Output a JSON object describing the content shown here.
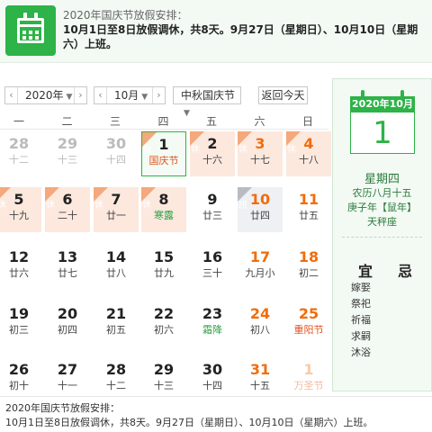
{
  "banner": {
    "icon": "calendar-icon",
    "title": "2020年国庆节放假安排：",
    "text": "10月1日至8日放假调休，共8天。9月27日（星期日）、10月10日（星期六）上班。"
  },
  "toolbar": {
    "year": "2020年",
    "month": "10月",
    "holiday": "中秋国庆节",
    "today_button": "返回今天",
    "prev": "‹",
    "next": "›"
  },
  "weekdays": [
    "一",
    "二",
    "三",
    "四",
    "五",
    "六",
    "日"
  ],
  "days": [
    {
      "num": "28",
      "lunar": "十二",
      "other": true
    },
    {
      "num": "29",
      "lunar": "十三",
      "other": true
    },
    {
      "num": "30",
      "lunar": "十四",
      "other": true
    },
    {
      "num": "1",
      "lunar": "国庆节",
      "tag": "休",
      "festival": true,
      "selected": true
    },
    {
      "num": "2",
      "lunar": "十六",
      "tag": "休"
    },
    {
      "num": "3",
      "lunar": "十七",
      "tag": "休",
      "weekend": true
    },
    {
      "num": "4",
      "lunar": "十八",
      "tag": "休",
      "weekend": true
    },
    {
      "num": "5",
      "lunar": "十九",
      "tag": "休"
    },
    {
      "num": "6",
      "lunar": "二十",
      "tag": "休"
    },
    {
      "num": "7",
      "lunar": "廿一",
      "tag": "休"
    },
    {
      "num": "8",
      "lunar": "寒露",
      "tag": "休",
      "green": true
    },
    {
      "num": "9",
      "lunar": "廿三"
    },
    {
      "num": "10",
      "lunar": "廿四",
      "tag": "班",
      "work": true
    },
    {
      "num": "11",
      "lunar": "廿五",
      "weekend": true
    },
    {
      "num": "12",
      "lunar": "廿六"
    },
    {
      "num": "13",
      "lunar": "廿七"
    },
    {
      "num": "14",
      "lunar": "廿八"
    },
    {
      "num": "15",
      "lunar": "廿九"
    },
    {
      "num": "16",
      "lunar": "三十"
    },
    {
      "num": "17",
      "lunar": "九月小",
      "weekend": true
    },
    {
      "num": "18",
      "lunar": "初二",
      "weekend": true
    },
    {
      "num": "19",
      "lunar": "初三"
    },
    {
      "num": "20",
      "lunar": "初四"
    },
    {
      "num": "21",
      "lunar": "初五"
    },
    {
      "num": "22",
      "lunar": "初六"
    },
    {
      "num": "23",
      "lunar": "霜降",
      "green": true
    },
    {
      "num": "24",
      "lunar": "初八",
      "weekend": true
    },
    {
      "num": "25",
      "lunar": "重阳节",
      "weekend": true,
      "festival": true
    },
    {
      "num": "26",
      "lunar": "初十"
    },
    {
      "num": "27",
      "lunar": "十一"
    },
    {
      "num": "28",
      "lunar": "十二"
    },
    {
      "num": "29",
      "lunar": "十三"
    },
    {
      "num": "30",
      "lunar": "十四"
    },
    {
      "num": "31",
      "lunar": "十五",
      "weekend": true
    },
    {
      "num": "1",
      "lunar": "万圣节",
      "other": true,
      "weekend": true,
      "festival": true
    }
  ],
  "panel": {
    "header": "2020年10月",
    "day": "1",
    "weekday": "星期四",
    "lunar": "农历八月十五",
    "ganzhi": "庚子年【鼠年】",
    "constellation": "天秤座",
    "yi_label": "宜",
    "ji_label": "忌",
    "yi_items": [
      "嫁娶",
      "祭祀",
      "祈福",
      "求嗣",
      "沐浴"
    ]
  },
  "bottom": {
    "title": "2020年国庆节放假安排：",
    "text": "10月1日至8日放假调休，共8天。9月27日（星期日）、10月10日（星期六）上班。"
  },
  "colors": {
    "accent": "#2db347",
    "holiday_bg": "#fde8de",
    "weekend_text": "#f26c0a"
  }
}
